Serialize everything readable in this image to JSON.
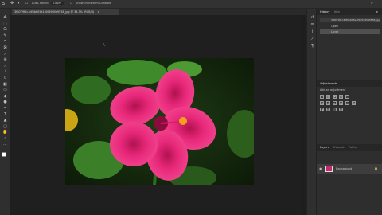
{
  "options_bar": {
    "home_icon": "home-icon",
    "tool_icon": "move-tool-icon",
    "auto_select_label": "Auto-Select:",
    "layer_value": "Layer",
    "transform_label": "Show Transform Controls",
    "right_text": "",
    "search_icon": "search-icon"
  },
  "document_tab": {
    "title": "3f8079f5c3df5b605e1f0059d5d9558_jpg @ 33.3% (RGB/8)",
    "close_icon": "close-icon"
  },
  "tools": [
    {
      "name": "move-tool",
      "glyph": "✥"
    },
    {
      "name": "marquee-tool",
      "glyph": "⬚"
    },
    {
      "name": "lasso-tool",
      "glyph": "ᘏ"
    },
    {
      "name": "quick-select-tool",
      "glyph": "✎"
    },
    {
      "name": "crop-tool",
      "glyph": "⌗"
    },
    {
      "name": "frame-tool",
      "glyph": "⊠"
    },
    {
      "name": "eyedropper-tool",
      "glyph": "⁄"
    },
    {
      "name": "healing-brush-tool",
      "glyph": "⊕"
    },
    {
      "name": "brush-tool",
      "glyph": "⁄"
    },
    {
      "name": "clone-stamp-tool",
      "glyph": "⊥"
    },
    {
      "name": "history-brush-tool",
      "glyph": "↺"
    },
    {
      "name": "eraser-tool",
      "glyph": "◧"
    },
    {
      "name": "gradient-tool",
      "glyph": "▭"
    },
    {
      "name": "blur-tool",
      "glyph": "◆"
    },
    {
      "name": "dodge-tool",
      "glyph": "●"
    },
    {
      "name": "pen-tool",
      "glyph": "✒"
    },
    {
      "name": "type-tool",
      "glyph": "T"
    },
    {
      "name": "path-select-tool",
      "glyph": "▲"
    },
    {
      "name": "rectangle-tool",
      "glyph": "▢"
    },
    {
      "name": "hand-tool",
      "glyph": "✋"
    },
    {
      "name": "zoom-tool",
      "glyph": "⌕"
    },
    {
      "name": "more-tools",
      "glyph": "⋯"
    }
  ],
  "panel_icons": [
    {
      "name": "history-panel-icon",
      "glyph": "↺"
    },
    {
      "name": "properties-panel-icon",
      "glyph": "≡"
    },
    {
      "name": "info-panel-icon",
      "glyph": "i"
    },
    {
      "name": "brush-panel-icon",
      "glyph": "⁄"
    },
    {
      "name": "paragraph-panel-icon",
      "glyph": "¶"
    }
  ],
  "history_panel": {
    "tabs": [
      "History",
      "Info"
    ],
    "items": [
      "3f8079f5c3df5b605e1f0059d5d9558_jpg",
      "Open",
      "Layer"
    ]
  },
  "adjustments_panel": {
    "title": "Adjustments",
    "subtitle": "Add an adjustment",
    "icons_row1": [
      "☀",
      "▦",
      "◩",
      "▨",
      "▽"
    ],
    "icons_row2": [
      "▣",
      "◑",
      "◐",
      "▩",
      "◎",
      "▤"
    ],
    "icons_row3": [
      "◪",
      "▥",
      "◫",
      "▧"
    ]
  },
  "layers_panel": {
    "tabs": [
      "Layers",
      "Channels",
      "Paths"
    ],
    "layer_name": "Background",
    "eye_icon": "eye-icon",
    "lock_icon": "lock-icon"
  },
  "colors": {
    "accent": "#3a7bd5",
    "flower": "#e8287a",
    "leaves": "#3f8a2b"
  }
}
